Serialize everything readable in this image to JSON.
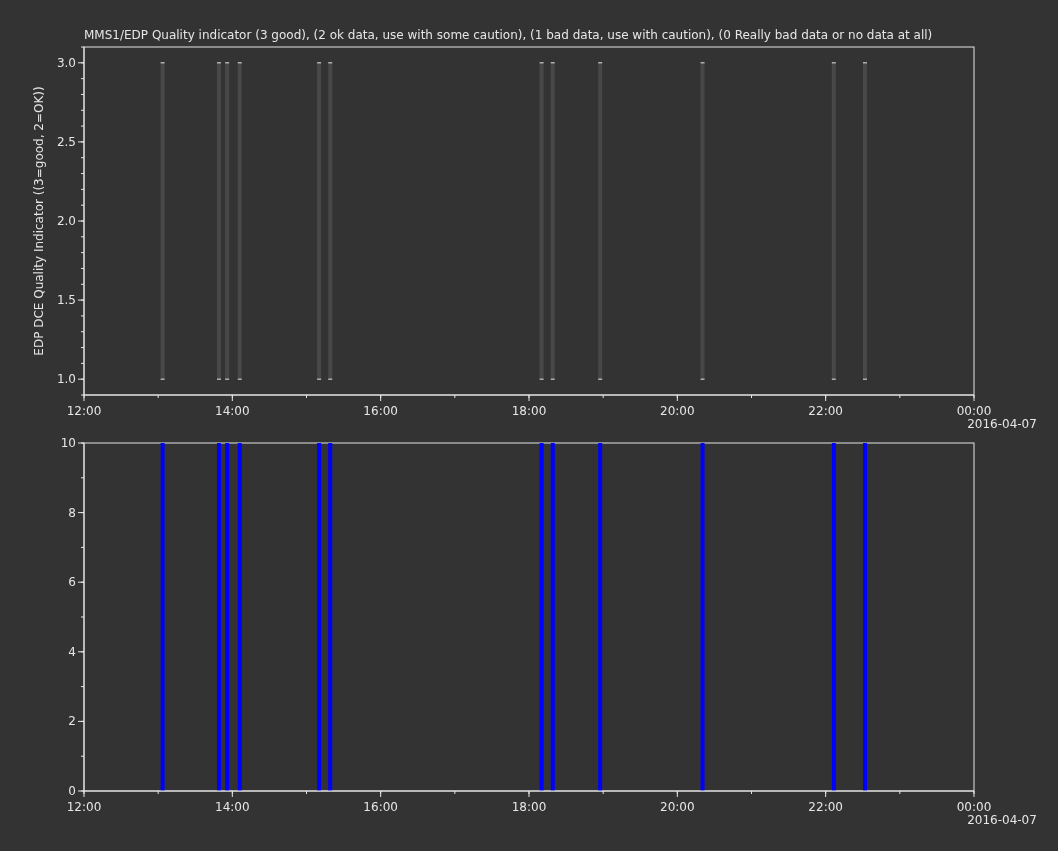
{
  "title": "MMS1/EDP  Quality indicator (3 good), (2 ok data, use with some caution), (1 bad data, use with caution), (0 Really bad data or no data at all)",
  "panels": [
    {
      "chart_data": {
        "type": "candlestick",
        "ylabel": "EDP DCE Quality Indicator ((3=good, 2=OK))",
        "x": [
          13.06,
          13.82,
          13.93,
          14.1,
          15.17,
          15.32,
          18.17,
          18.32,
          18.96,
          20.34,
          22.11,
          22.53
        ],
        "ohlc": [
          [
            1,
            3,
            1,
            3
          ],
          [
            1,
            3,
            1,
            3
          ],
          [
            1,
            3,
            1,
            3
          ],
          [
            1,
            3,
            1,
            3
          ],
          [
            1,
            3,
            1,
            3
          ],
          [
            1,
            3,
            1,
            3
          ],
          [
            1,
            3,
            1,
            3
          ],
          [
            1,
            3,
            1,
            3
          ],
          [
            1,
            3,
            1,
            3
          ],
          [
            1,
            3,
            1,
            3
          ],
          [
            1,
            3,
            1,
            3
          ],
          [
            1,
            3,
            1,
            3
          ]
        ],
        "xlim": [
          12,
          24
        ],
        "ylim": [
          0.9,
          3.1
        ],
        "xticks": [
          {
            "value": 12,
            "label": "12:00"
          },
          {
            "value": 14,
            "label": "14:00"
          },
          {
            "value": 16,
            "label": "16:00"
          },
          {
            "value": 18,
            "label": "18:00"
          },
          {
            "value": 20,
            "label": "20:00"
          },
          {
            "value": 22,
            "label": "22:00"
          },
          {
            "value": 24,
            "label": "00:00"
          }
        ],
        "yticks": [
          {
            "value": 1,
            "label": "1.0"
          },
          {
            "value": 1.5,
            "label": "1.5"
          },
          {
            "value": 2,
            "label": "2.0"
          },
          {
            "value": 2.5,
            "label": "2.5"
          },
          {
            "value": 3,
            "label": "3.0"
          }
        ],
        "annotations": [
          "2016-04-07"
        ]
      }
    },
    {
      "chart_data": {
        "type": "bar",
        "x": [
          13.06,
          13.82,
          13.93,
          14.1,
          15.17,
          15.32,
          18.17,
          18.32,
          18.96,
          20.34,
          22.11,
          22.53
        ],
        "series": [
          {
            "color": "#0000ff",
            "values": [
              10,
              10,
              10,
              10,
              10,
              10,
              10,
              10,
              10,
              10,
              10,
              10
            ]
          }
        ],
        "xlim": [
          12,
          24
        ],
        "ylim": [
          0,
          10
        ],
        "xticks": [
          {
            "value": 12,
            "label": "12:00"
          },
          {
            "value": 14,
            "label": "14:00"
          },
          {
            "value": 16,
            "label": "16:00"
          },
          {
            "value": 18,
            "label": "18:00"
          },
          {
            "value": 20,
            "label": "20:00"
          },
          {
            "value": 22,
            "label": "22:00"
          },
          {
            "value": 24,
            "label": "00:00"
          }
        ],
        "yticks": [
          0,
          2,
          4,
          6,
          8,
          10
        ],
        "annotations": [
          "2016-04-07"
        ]
      }
    }
  ]
}
